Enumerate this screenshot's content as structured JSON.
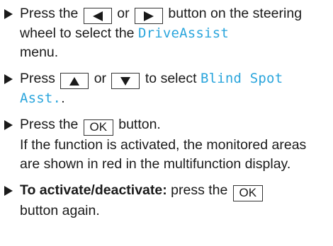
{
  "steps": [
    {
      "text_a": "Press the",
      "key_1": "left-arrow-key",
      "text_b": "or",
      "key_2": "right-arrow-key",
      "text_c": "button on the steering wheel to select the",
      "display": "DriveAssist",
      "text_d": "menu."
    },
    {
      "text_a": "Press",
      "key_1": "up-arrow-key",
      "text_b": "or",
      "key_2": "down-arrow-key",
      "text_c": "to select",
      "display": "Blind Spot Asst.",
      "text_d": "."
    },
    {
      "text_a": "Press the",
      "key_label": "OK",
      "text_b": "button.",
      "text_c": "If the function is activated, the monitored areas are shown in red in the multifunction display."
    },
    {
      "bold_text": "To activate/deactivate:",
      "text_a": "press the",
      "key_label": "OK",
      "text_b": "button again."
    }
  ],
  "colors": {
    "display_text": "#2aa5dc",
    "body_text": "#1a1a1a",
    "key_border": "#333333"
  }
}
